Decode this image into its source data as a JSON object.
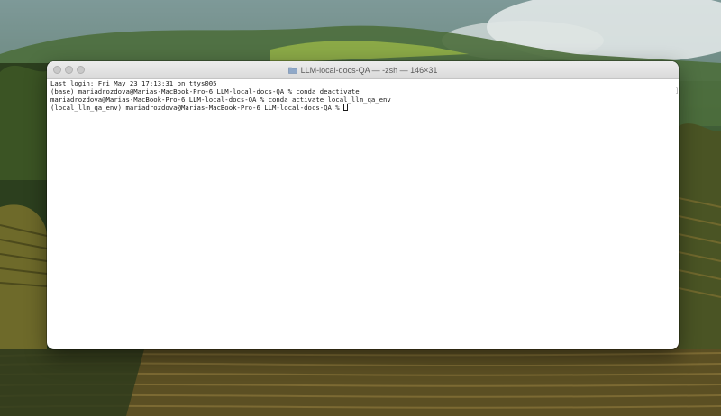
{
  "window": {
    "title": "LLM-local-docs-QA — -zsh — 146×31"
  },
  "terminal": {
    "lines": [
      "Last login: Fri May 23 17:13:31 on ttys005",
      "(base) mariadrozdova@Marias-MacBook-Pro-6 LLM-local-docs-QA % conda deactivate",
      "mariadrozdova@Marias-MacBook-Pro-6 LLM-local-docs-QA % conda activate local_llm_qa_env",
      "(local_llm_qa_env) mariadrozdova@Marias-MacBook-Pro-6 LLM-local-docs-QA % "
    ]
  },
  "icons": [
    "close-button",
    "minimize-button",
    "maximize-button",
    "folder-icon",
    "text-cursor"
  ]
}
